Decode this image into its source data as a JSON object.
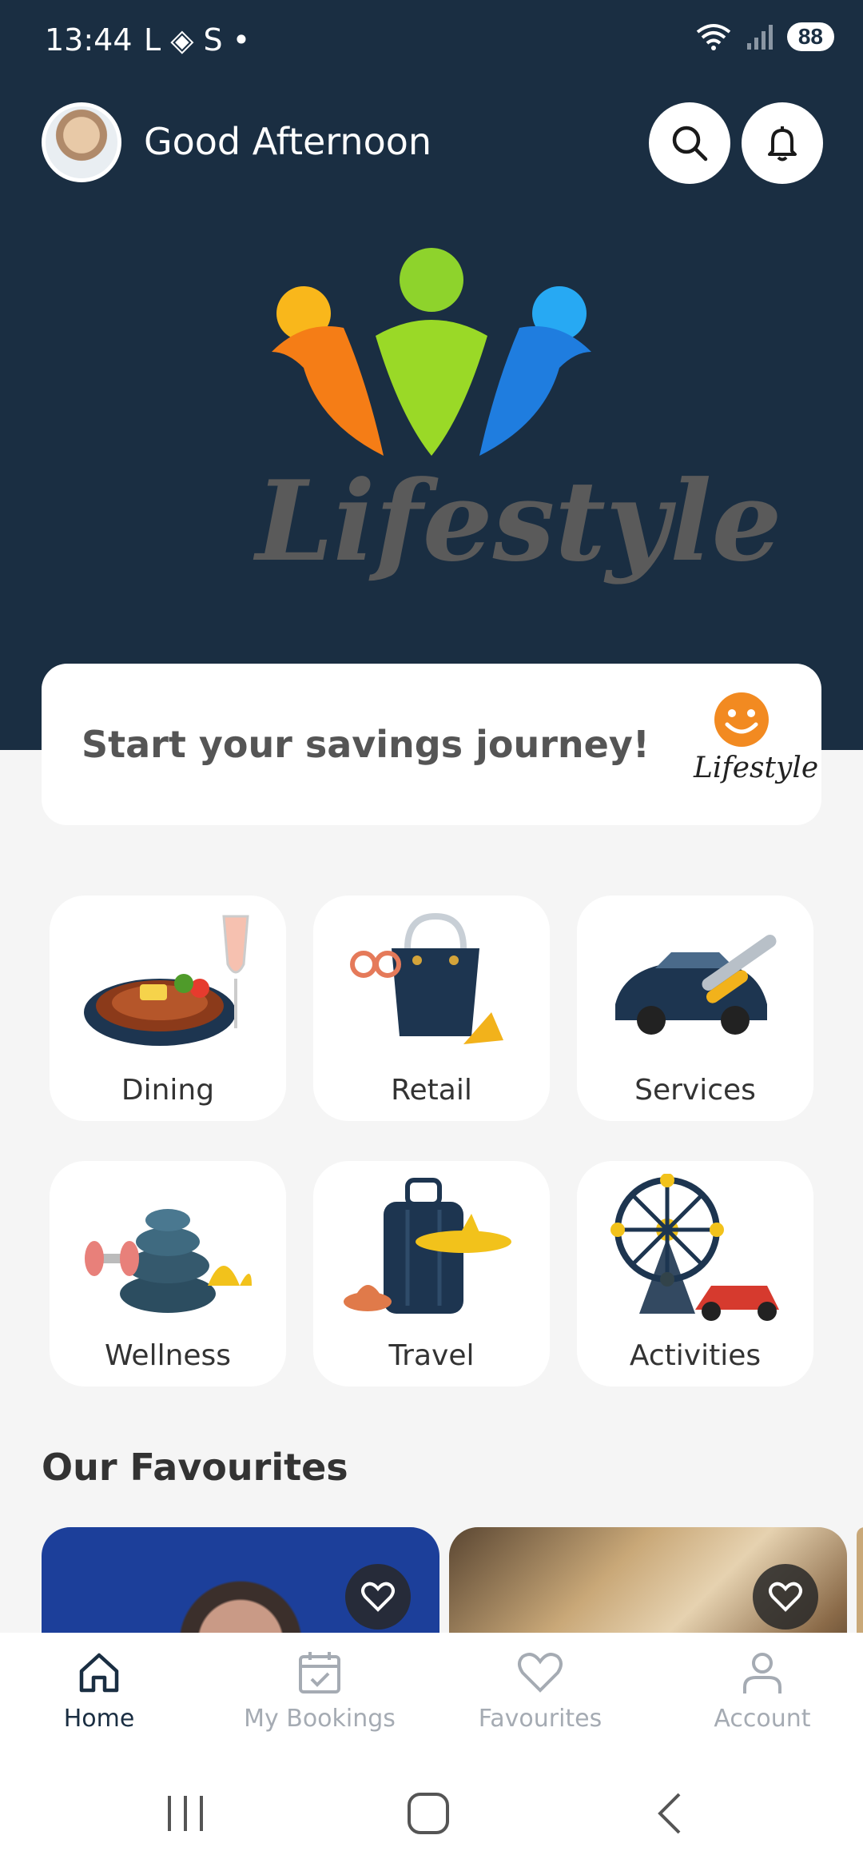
{
  "status_bar": {
    "time": "13:44",
    "notif_icons": "L ◈ S •",
    "battery": "88"
  },
  "header": {
    "greeting": "Good Afternoon"
  },
  "logo": {
    "text": "Lifestyle"
  },
  "savings_card": {
    "text": "Start your savings journey!",
    "logo_text": "Lifestyle"
  },
  "categories": [
    {
      "label": "Dining",
      "icon": "dining-icon"
    },
    {
      "label": "Retail",
      "icon": "retail-icon"
    },
    {
      "label": "Services",
      "icon": "services-icon"
    },
    {
      "label": "Wellness",
      "icon": "wellness-icon"
    },
    {
      "label": "Travel",
      "icon": "travel-icon"
    },
    {
      "label": "Activities",
      "icon": "activities-icon"
    }
  ],
  "favourites": {
    "title": "Our Favourites"
  },
  "bottom_nav": [
    {
      "label": "Home",
      "active": true
    },
    {
      "label": "My Bookings",
      "active": false
    },
    {
      "label": "Favourites",
      "active": false
    },
    {
      "label": "Account",
      "active": false
    }
  ],
  "colors": {
    "primary": "#1a2e42",
    "background": "#f5f5f5",
    "inactive": "#a5abb3"
  }
}
